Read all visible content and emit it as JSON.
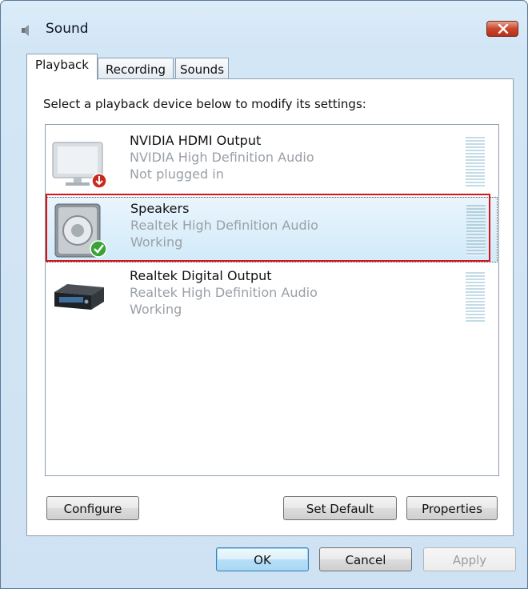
{
  "window": {
    "title": "Sound",
    "close_label": "×"
  },
  "tabs": [
    {
      "label": "Playback",
      "active": true
    },
    {
      "label": "Recording",
      "active": false
    },
    {
      "label": "Sounds",
      "active": false
    }
  ],
  "instruction": "Select a playback device below to modify its settings:",
  "devices": [
    {
      "name": "NVIDIA HDMI Output",
      "driver": "NVIDIA High Definition Audio",
      "status": "Not plugged in",
      "icon": "monitor-icon",
      "status_icon": "unplugged-icon",
      "selected": false
    },
    {
      "name": "Speakers",
      "driver": "Realtek High Definition Audio",
      "status": "Working",
      "icon": "speaker-icon",
      "status_icon": "default-check-icon",
      "selected": true
    },
    {
      "name": "Realtek Digital Output",
      "driver": "Realtek High Definition Audio",
      "status": "Working",
      "icon": "digital-output-icon",
      "status_icon": "",
      "selected": false
    }
  ],
  "buttons": {
    "configure": "Configure",
    "set_default": "Set Default",
    "properties": "Properties",
    "ok": "OK",
    "cancel": "Cancel",
    "apply": "Apply"
  },
  "colors": {
    "highlight_border": "#d3151a",
    "close_button": "#c9452b",
    "selection": "#d1eaf9"
  }
}
